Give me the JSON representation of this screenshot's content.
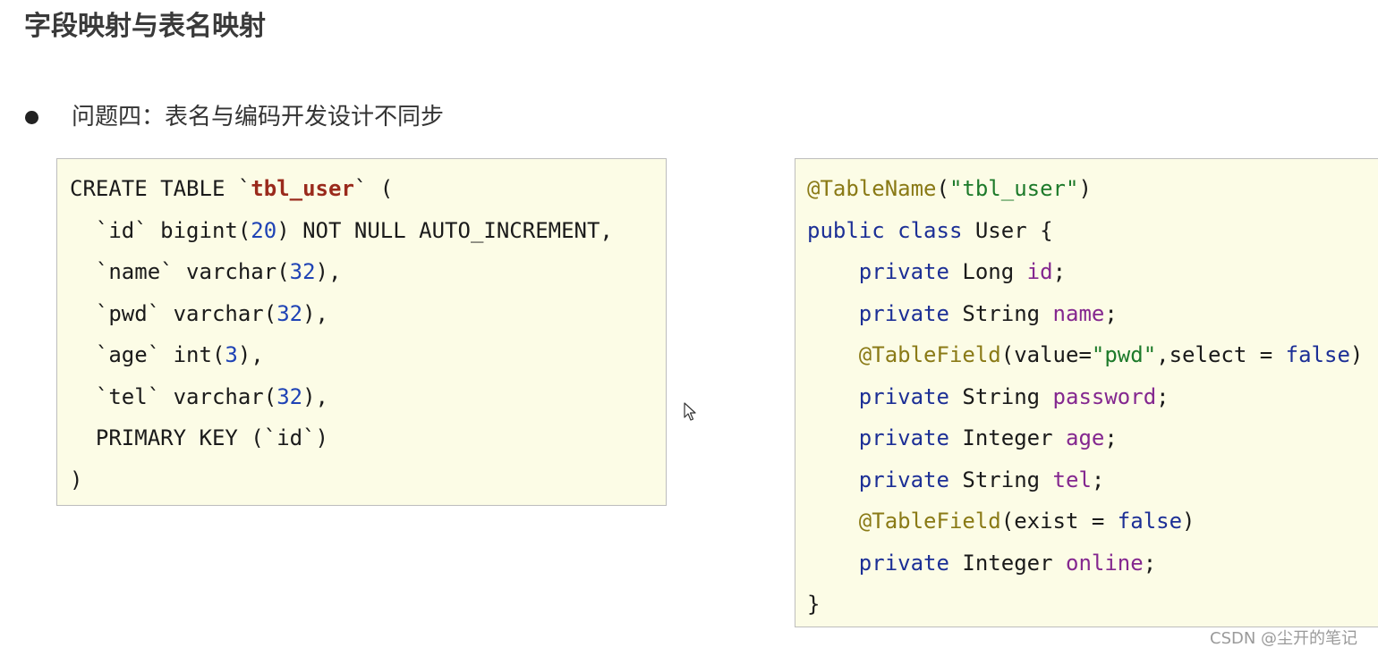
{
  "page": {
    "title": "字段映射与表名映射",
    "bullet": "问题四：表名与编码开发设计不同步",
    "watermark": "CSDN @尘开的笔记"
  },
  "colors": {
    "panel_background": "#fcfce6",
    "sql_table_name": "#9a2a1c",
    "number": "#1f43b5",
    "keyword": "#1c2f96",
    "annotation": "#8a7a16",
    "string": "#1d7a2a",
    "field_name": "#84278f"
  },
  "sql_code": {
    "lines": [
      [
        {
          "text": "CREATE TABLE `",
          "style": "plain"
        },
        {
          "text": "tbl_user",
          "style": "table"
        },
        {
          "text": "` (",
          "style": "plain"
        }
      ],
      [
        {
          "text": "  `id` bigint(",
          "style": "plain"
        },
        {
          "text": "20",
          "style": "num"
        },
        {
          "text": ") NOT NULL AUTO_INCREMENT,",
          "style": "plain"
        }
      ],
      [
        {
          "text": "  `name` varchar(",
          "style": "plain"
        },
        {
          "text": "32",
          "style": "num"
        },
        {
          "text": "),",
          "style": "plain"
        }
      ],
      [
        {
          "text": "  `pwd` varchar(",
          "style": "plain"
        },
        {
          "text": "32",
          "style": "num"
        },
        {
          "text": "),",
          "style": "plain"
        }
      ],
      [
        {
          "text": "  `age` int(",
          "style": "plain"
        },
        {
          "text": "3",
          "style": "num"
        },
        {
          "text": "),",
          "style": "plain"
        }
      ],
      [
        {
          "text": "  `tel` varchar(",
          "style": "plain"
        },
        {
          "text": "32",
          "style": "num"
        },
        {
          "text": "),",
          "style": "plain"
        }
      ],
      [
        {
          "text": "  PRIMARY KEY (`id`)",
          "style": "plain"
        }
      ],
      [
        {
          "text": ")",
          "style": "plain"
        }
      ]
    ]
  },
  "java_code": {
    "lines": [
      [
        {
          "text": "@TableName",
          "style": "anno"
        },
        {
          "text": "(",
          "style": "plain"
        },
        {
          "text": "\"tbl_user\"",
          "style": "str"
        },
        {
          "text": ")",
          "style": "plain"
        }
      ],
      [
        {
          "text": "public class",
          "style": "kw"
        },
        {
          "text": " User {",
          "style": "plain"
        }
      ],
      [
        {
          "text": "    ",
          "style": "plain"
        },
        {
          "text": "private",
          "style": "kw"
        },
        {
          "text": " Long ",
          "style": "plain"
        },
        {
          "text": "id",
          "style": "field"
        },
        {
          "text": ";",
          "style": "plain"
        }
      ],
      [
        {
          "text": "    ",
          "style": "plain"
        },
        {
          "text": "private",
          "style": "kw"
        },
        {
          "text": " String ",
          "style": "plain"
        },
        {
          "text": "name",
          "style": "field"
        },
        {
          "text": ";",
          "style": "plain"
        }
      ],
      [
        {
          "text": "    ",
          "style": "plain"
        },
        {
          "text": "@TableField",
          "style": "anno"
        },
        {
          "text": "(value=",
          "style": "plain"
        },
        {
          "text": "\"pwd\"",
          "style": "str"
        },
        {
          "text": ",select = ",
          "style": "plain"
        },
        {
          "text": "false",
          "style": "kw"
        },
        {
          "text": ")",
          "style": "plain"
        }
      ],
      [
        {
          "text": "    ",
          "style": "plain"
        },
        {
          "text": "private",
          "style": "kw"
        },
        {
          "text": " String ",
          "style": "plain"
        },
        {
          "text": "password",
          "style": "field"
        },
        {
          "text": ";",
          "style": "plain"
        }
      ],
      [
        {
          "text": "    ",
          "style": "plain"
        },
        {
          "text": "private",
          "style": "kw"
        },
        {
          "text": " Integer ",
          "style": "plain"
        },
        {
          "text": "age",
          "style": "field"
        },
        {
          "text": ";",
          "style": "plain"
        }
      ],
      [
        {
          "text": "    ",
          "style": "plain"
        },
        {
          "text": "private",
          "style": "kw"
        },
        {
          "text": " String ",
          "style": "plain"
        },
        {
          "text": "tel",
          "style": "field"
        },
        {
          "text": ";",
          "style": "plain"
        }
      ],
      [
        {
          "text": "    ",
          "style": "plain"
        },
        {
          "text": "@TableField",
          "style": "anno"
        },
        {
          "text": "(exist = ",
          "style": "plain"
        },
        {
          "text": "false",
          "style": "kw"
        },
        {
          "text": ")",
          "style": "plain"
        }
      ],
      [
        {
          "text": "    ",
          "style": "plain"
        },
        {
          "text": "private",
          "style": "kw"
        },
        {
          "text": " Integer ",
          "style": "plain"
        },
        {
          "text": "online",
          "style": "field"
        },
        {
          "text": ";",
          "style": "plain"
        }
      ],
      [
        {
          "text": "}",
          "style": "plain"
        }
      ]
    ]
  },
  "icons": {
    "cursor": "mouse-pointer-icon"
  }
}
